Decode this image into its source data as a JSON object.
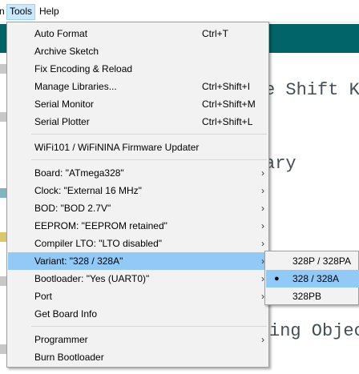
{
  "menubar": {
    "items": [
      {
        "label": "n"
      },
      {
        "label": "Tools"
      },
      {
        "label": "Help"
      }
    ]
  },
  "background_code": {
    "line1": "e Shift K",
    "line2": "ary",
    "line3": "ing Object"
  },
  "tools_menu": {
    "items": [
      {
        "label": "Auto Format",
        "shortcut": "Ctrl+T"
      },
      {
        "label": "Archive Sketch",
        "shortcut": ""
      },
      {
        "label": "Fix Encoding & Reload",
        "shortcut": ""
      },
      {
        "label": "Manage Libraries...",
        "shortcut": "Ctrl+Shift+I"
      },
      {
        "label": "Serial Monitor",
        "shortcut": "Ctrl+Shift+M"
      },
      {
        "label": "Serial Plotter",
        "shortcut": "Ctrl+Shift+L"
      },
      {
        "label": "WiFi101 / WiFiNINA Firmware Updater",
        "shortcut": ""
      },
      {
        "label": "Board: \"ATmega328\"",
        "submenu": true
      },
      {
        "label": "Clock: \"External 16 MHz\"",
        "submenu": true
      },
      {
        "label": "BOD: \"BOD 2.7V\"",
        "submenu": true
      },
      {
        "label": "EEPROM: \"EEPROM retained\"",
        "submenu": true
      },
      {
        "label": "Compiler LTO: \"LTO disabled\"",
        "submenu": true
      },
      {
        "label": "Variant: \"328 / 328A\"",
        "submenu": true,
        "highlighted": true
      },
      {
        "label": "Bootloader: \"Yes (UART0)\"",
        "submenu": true
      },
      {
        "label": "Port",
        "submenu": true
      },
      {
        "label": "Get Board Info"
      },
      {
        "label": "Programmer",
        "submenu": true
      },
      {
        "label": "Burn Bootloader"
      }
    ],
    "arrow_glyph": "›"
  },
  "variant_submenu": {
    "items": [
      {
        "label": "328P / 328PA",
        "selected": false
      },
      {
        "label": "328 / 328A",
        "selected": true
      },
      {
        "label": "328PB",
        "selected": false
      }
    ],
    "bullet_glyph": "●"
  },
  "colors": {
    "highlight": "#91c9f7",
    "menu_bg": "#f2f2f2",
    "teal": "#006468"
  }
}
